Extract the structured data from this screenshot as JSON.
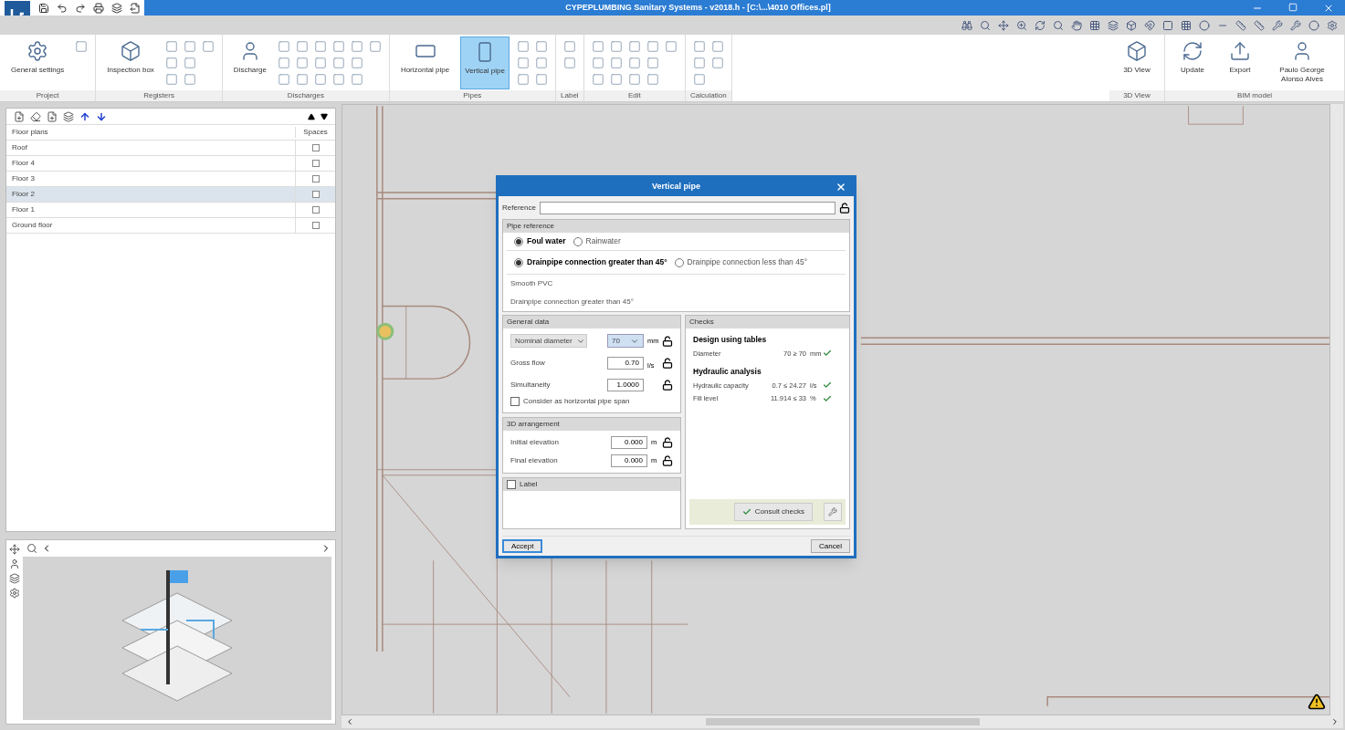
{
  "window": {
    "title": "CYPEPLUMBING Sanitary Systems - v2018.h - [C:\\...\\4010 Offices.pl]"
  },
  "ribbon": {
    "left_groups": [
      {
        "label": "Project",
        "buttons": [
          {
            "label": "General settings",
            "selected": false
          }
        ]
      },
      {
        "label": "Registers",
        "buttons": [
          {
            "label": "Inspection box",
            "selected": false
          }
        ]
      },
      {
        "label": "Discharges",
        "buttons": [
          {
            "label": "Discharge",
            "selected": false
          }
        ]
      },
      {
        "label": "Pipes",
        "buttons": [
          {
            "label": "Horizontal pipe",
            "selected": false
          },
          {
            "label": "Vertical pipe",
            "selected": true
          }
        ]
      },
      {
        "label": "Label"
      },
      {
        "label": "Edit"
      },
      {
        "label": "Calculation"
      }
    ],
    "right_groups": [
      {
        "label": "3D View",
        "buttons": [
          {
            "label": "3D View",
            "selected": false
          }
        ]
      },
      {
        "label": "BIM model",
        "buttons": [
          {
            "label": "Update",
            "selected": false
          },
          {
            "label": "Export",
            "selected": false
          },
          {
            "label": "Paulo George Alonso Alves",
            "selected": false
          }
        ]
      }
    ]
  },
  "floor_panel": {
    "columns": [
      "Floor plans",
      "Spaces"
    ],
    "rows": [
      {
        "name": "Roof",
        "selected": false,
        "spaces": false
      },
      {
        "name": "Floor 4",
        "selected": false,
        "spaces": false
      },
      {
        "name": "Floor 3",
        "selected": false,
        "spaces": false
      },
      {
        "name": "Floor 2",
        "selected": true,
        "spaces": false
      },
      {
        "name": "Floor 1",
        "selected": false,
        "spaces": false
      },
      {
        "name": "Ground floor",
        "selected": false,
        "spaces": false
      }
    ]
  },
  "dialog": {
    "title": "Vertical pipe",
    "reference_label": "Reference",
    "pipe_reference": {
      "title": "Pipe reference",
      "water_type": [
        {
          "label": "Foul water",
          "selected": true
        },
        {
          "label": "Rainwater",
          "selected": false
        }
      ],
      "connection": [
        {
          "label": "Drainpipe connection greater than 45°",
          "selected": true
        },
        {
          "label": "Drainpipe connection less than 45°",
          "selected": false
        }
      ],
      "material": "Smooth PVC",
      "description": "Drainpipe connection greater than 45°"
    },
    "general_data": {
      "title": "General data",
      "diameter_type": "Nominal diameter",
      "diameter": "70",
      "diameter_unit": "mm",
      "fields": [
        {
          "label": "Gross flow",
          "value": "0.70",
          "unit": "l/s"
        },
        {
          "label": "Simultaneity",
          "value": "1.0000"
        }
      ],
      "horizontal_span": {
        "label": "Consider as horizontal pipe span",
        "checked": false
      }
    },
    "arrangement": {
      "title": "3D arrangement",
      "fields": [
        {
          "label": "Initial elevation",
          "value": "0.000",
          "unit": "m"
        },
        {
          "label": "Final elevation",
          "value": "0.000",
          "unit": "m"
        }
      ]
    },
    "label_section": {
      "title": "Label",
      "checked": false
    },
    "checks": {
      "title": "Checks",
      "groups": [
        {
          "title": "Design using tables",
          "rows": [
            {
              "label": "Diameter",
              "value": "70 ≥ 70",
              "unit": "mm",
              "passed": true
            }
          ]
        },
        {
          "title": "Hydraulic analysis",
          "rows": [
            {
              "label": "Hydraulic capacity",
              "value": "0.7 ≤ 24.27",
              "unit": "l/s",
              "passed": true
            },
            {
              "label": "Fill level",
              "value": "11.914 ≤ 33",
              "unit": "%",
              "passed": true
            }
          ]
        }
      ],
      "consult_button": "Consult checks"
    },
    "accept": "Accept",
    "cancel": "Cancel"
  }
}
